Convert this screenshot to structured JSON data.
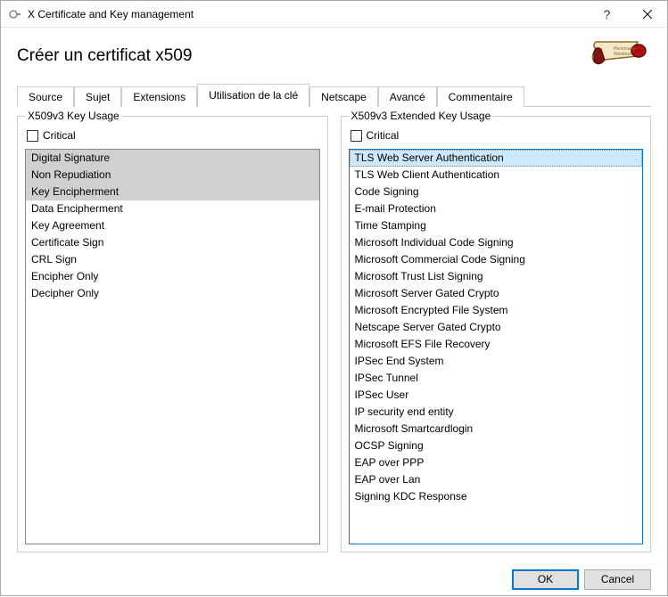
{
  "window": {
    "title": "X Certificate and Key management"
  },
  "page": {
    "title": "Créer un certificat x509"
  },
  "tabs": {
    "items": [
      {
        "label": "Source"
      },
      {
        "label": "Sujet"
      },
      {
        "label": "Extensions"
      },
      {
        "label": "Utilisation de la clé"
      },
      {
        "label": "Netscape"
      },
      {
        "label": "Avancé"
      },
      {
        "label": "Commentaire"
      }
    ],
    "active_index": 3
  },
  "left_group": {
    "title": "X509v3 Key Usage",
    "critical_label": "Critical",
    "critical_checked": false,
    "items": [
      {
        "label": "Digital Signature",
        "selected": true
      },
      {
        "label": "Non Repudiation",
        "selected": true
      },
      {
        "label": "Key Encipherment",
        "selected": true
      },
      {
        "label": "Data Encipherment",
        "selected": false
      },
      {
        "label": "Key Agreement",
        "selected": false
      },
      {
        "label": "Certificate Sign",
        "selected": false
      },
      {
        "label": "CRL Sign",
        "selected": false
      },
      {
        "label": "Encipher Only",
        "selected": false
      },
      {
        "label": "Decipher Only",
        "selected": false
      }
    ]
  },
  "right_group": {
    "title": "X509v3 Extended Key Usage",
    "critical_label": "Critical",
    "critical_checked": false,
    "items": [
      {
        "label": "TLS Web Server Authentication",
        "selected": true
      },
      {
        "label": "TLS Web Client Authentication",
        "selected": false
      },
      {
        "label": "Code Signing",
        "selected": false
      },
      {
        "label": "E-mail Protection",
        "selected": false
      },
      {
        "label": "Time Stamping",
        "selected": false
      },
      {
        "label": "Microsoft Individual Code Signing",
        "selected": false
      },
      {
        "label": "Microsoft Commercial Code Signing",
        "selected": false
      },
      {
        "label": "Microsoft Trust List Signing",
        "selected": false
      },
      {
        "label": "Microsoft Server Gated Crypto",
        "selected": false
      },
      {
        "label": "Microsoft Encrypted File System",
        "selected": false
      },
      {
        "label": "Netscape Server Gated Crypto",
        "selected": false
      },
      {
        "label": "Microsoft EFS File Recovery",
        "selected": false
      },
      {
        "label": "IPSec End System",
        "selected": false
      },
      {
        "label": "IPSec Tunnel",
        "selected": false
      },
      {
        "label": "IPSec User",
        "selected": false
      },
      {
        "label": "IP security end entity",
        "selected": false
      },
      {
        "label": "Microsoft Smartcardlogin",
        "selected": false
      },
      {
        "label": "OCSP Signing",
        "selected": false
      },
      {
        "label": "EAP over PPP",
        "selected": false
      },
      {
        "label": "EAP over Lan",
        "selected": false
      },
      {
        "label": "Signing KDC Response",
        "selected": false
      }
    ]
  },
  "buttons": {
    "ok": "OK",
    "cancel": "Cancel"
  }
}
